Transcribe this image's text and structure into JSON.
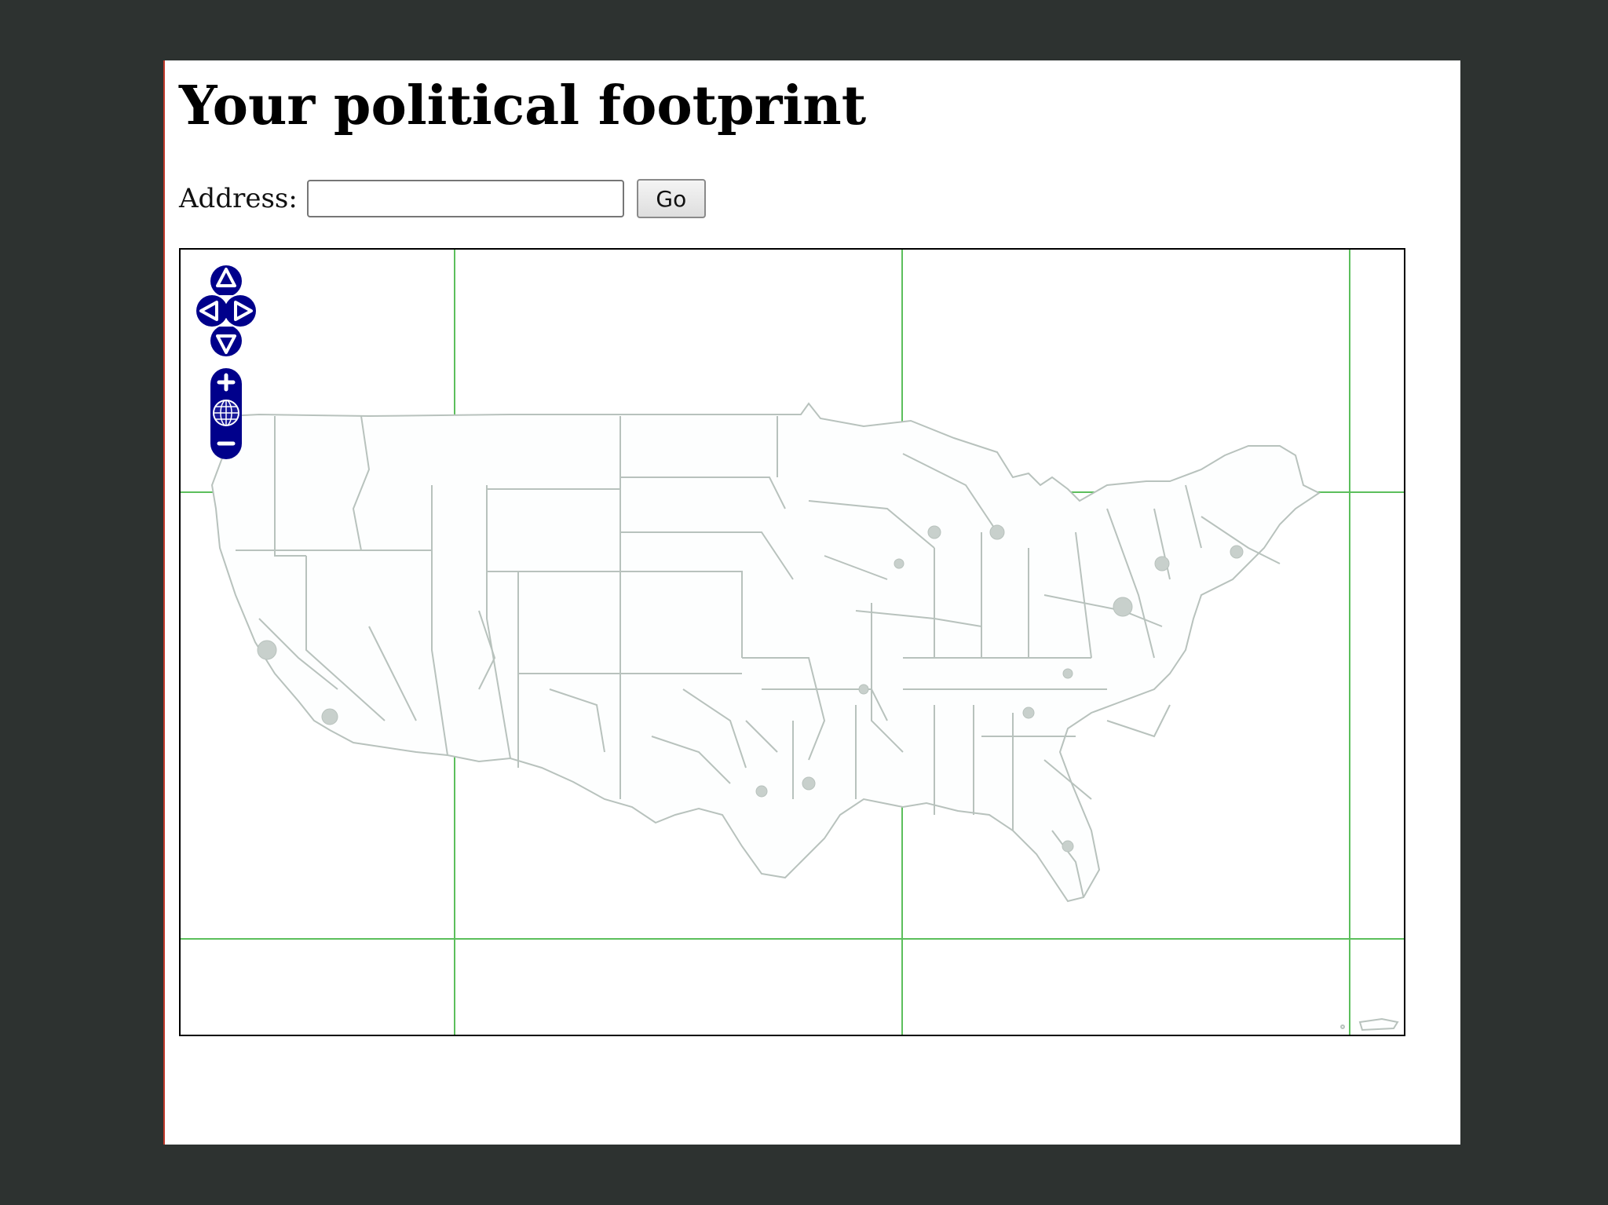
{
  "page": {
    "title": "Your political footprint"
  },
  "form": {
    "address_label": "Address:",
    "address_value": "",
    "address_placeholder": "",
    "go_label": "Go"
  },
  "map": {
    "controls": {
      "pan_up_icon": "triangle-up-icon",
      "pan_left_icon": "triangle-left-icon",
      "pan_right_icon": "triangle-right-icon",
      "pan_down_icon": "triangle-down-icon",
      "zoom_in_icon": "plus-icon",
      "zoom_world_icon": "globe-icon",
      "zoom_out_icon": "minus-icon"
    },
    "colors": {
      "control": "#00008b",
      "graticule": "#5cbf5c",
      "boundaries": "#b8c2bd",
      "border": "#000000"
    }
  }
}
